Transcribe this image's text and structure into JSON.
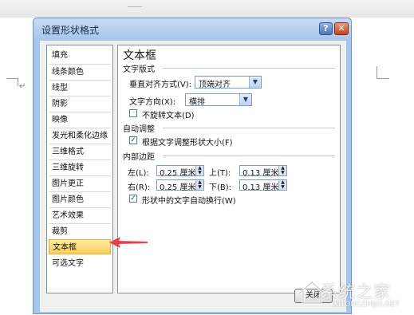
{
  "dialog": {
    "title": "设置形状格式",
    "help_label": "?",
    "close_label": "✕",
    "close_button_label": "关闭"
  },
  "categories": [
    "填充",
    "线条颜色",
    "线型",
    "阴影",
    "映像",
    "发光和柔化边缘",
    "三维格式",
    "三维旋转",
    "图片更正",
    "图片颜色",
    "艺术效果",
    "裁剪",
    "文本框",
    "可选文字"
  ],
  "selected_category": "文本框",
  "panel": {
    "title": "文本框",
    "layout_section": "文字版式",
    "vertical_align_label": "垂直对齐方式(V):",
    "vertical_align_value": "顶端对齐",
    "text_direction_label": "文字方向(X):",
    "text_direction_value": "横排",
    "no_rotate_label": "不旋转文本(D)",
    "no_rotate_checked": false,
    "autofit_section": "自动调整",
    "resize_label": "根据文字调整形状大小(F)",
    "resize_checked": true,
    "margins_section": "内部边距",
    "left_label": "左(L):",
    "left_value": "0.25 厘米",
    "top_label": "上(T):",
    "top_value": "0.13 厘米",
    "right_label": "右(R):",
    "right_value": "0.25 厘米",
    "bottom_label": "下(B):",
    "bottom_value": "0.13 厘米",
    "wrap_label": "形状中的文字自动换行(W)",
    "wrap_checked": true
  },
  "watermark": {
    "text": "系统之家",
    "site": "XITONGZHIJIA.NET"
  },
  "paragraph_mark": "↵",
  "colors": {
    "selection": "#f9cf5d",
    "annotation_arrow": "#e8404a",
    "dialog_frame": "#a7c6ec"
  }
}
